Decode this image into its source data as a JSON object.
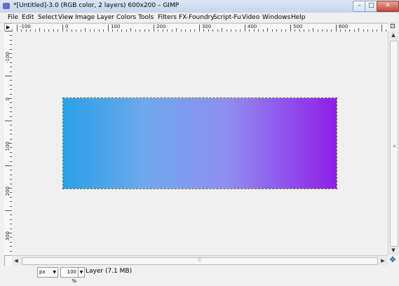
{
  "window": {
    "title": "*[Untitled]-3.0 (RGB color, 2 layers) 600x200 – GIMP",
    "min_glyph": "–",
    "max_glyph": "□",
    "close_glyph": "✕"
  },
  "menubar": {
    "items": [
      "File",
      "Edit",
      "Select",
      "View",
      "Image",
      "Layer",
      "Colors",
      "Tools",
      "Filters",
      "FX-Foundry",
      "Script-Fu",
      "Video",
      "Windows",
      "Help"
    ]
  },
  "rulers": {
    "horizontal_labels": [
      "-100",
      "0",
      "100",
      "200",
      "300",
      "400",
      "500",
      "600"
    ],
    "vertical_labels": [
      "-100",
      "0",
      "100",
      "200",
      "300"
    ]
  },
  "canvas": {
    "gradient_start": "#2aa0e8",
    "gradient_end": "#8f1ee8"
  },
  "statusbar": {
    "unit": "px",
    "zoom": "100 %",
    "info": "Layer (7.1 MB)"
  },
  "icons": [
    "gimp-icon",
    "minimize-icon",
    "maximize-icon",
    "close-icon",
    "ruler-corner-icon",
    "navigate-icon",
    "quick-mask-icon",
    "zoom-dropdown-icon"
  ]
}
